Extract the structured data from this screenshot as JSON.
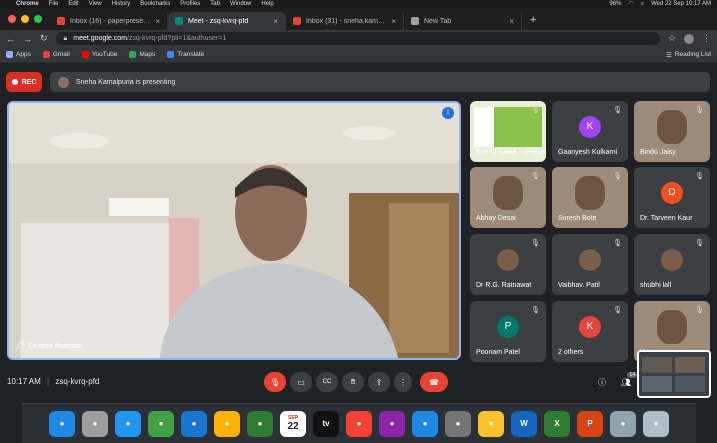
{
  "menubar": {
    "app_name": "Chrome",
    "items": [
      "File",
      "Edit",
      "View",
      "History",
      "Bookmarks",
      "Profiles",
      "Tab",
      "Window",
      "Help"
    ],
    "battery": "96%",
    "datetime": "Wed 22 Sep  10:17 AM"
  },
  "tabs": [
    {
      "title": "Inbox (16) - paperpresentation",
      "color": "#ea4335"
    },
    {
      "title": "Meet - zsq-kvrq-pfd",
      "color": "#00897b",
      "active": true
    },
    {
      "title": "Inbox (31) - sneha.kamalpuria",
      "color": "#ea4335"
    },
    {
      "title": "New Tab",
      "color": "#9aa0a6"
    }
  ],
  "address": {
    "host": "meet.google.com",
    "path": "/zsq-kvrq-pfd?pli=1&authuser=1"
  },
  "bookmarks": {
    "items": [
      {
        "label": "Apps",
        "color": "#8ab4f8"
      },
      {
        "label": "Gmail",
        "color": "#ea4335"
      },
      {
        "label": "YouTube",
        "color": "#ff0000"
      },
      {
        "label": "Maps",
        "color": "#34a853"
      },
      {
        "label": "Translate",
        "color": "#4285f4"
      }
    ],
    "reading_list": "Reading List"
  },
  "meet": {
    "rec_label": "REC",
    "presenting_text": "Sneha Kamalpuria is presenting",
    "main_speaker": "Deepak Asarpota",
    "participants": [
      {
        "name": "Sneha Kama... (Presentati...",
        "kind": "screen"
      },
      {
        "name": "Gaanyesh Kulkarni",
        "initial": "K",
        "color": "#a142f4"
      },
      {
        "name": "Bindu Jaisy",
        "kind": "photo"
      },
      {
        "name": "Abhay Desai",
        "kind": "photo"
      },
      {
        "name": "Suresh Bote",
        "kind": "photo"
      },
      {
        "name": "Dr. Tarveen Kaur",
        "initial": "D",
        "color": "#f4511e"
      },
      {
        "name": "Dr R.G. Ratnawat",
        "kind": "avatar"
      },
      {
        "name": "Vaibhav. Patil",
        "kind": "avatar"
      },
      {
        "name": "shubhi lall",
        "kind": "avatar"
      },
      {
        "name": "Poonam Patel",
        "initial": "P",
        "color": "#00796b"
      },
      {
        "name": "2 others",
        "initial": "K",
        "color": "#e8453c"
      },
      {
        "name": "You",
        "kind": "photo"
      }
    ],
    "clock": "10:17 AM",
    "meeting_code": "zsq-kvrq-pfd",
    "people_count": "14"
  },
  "dock": {
    "apps": [
      {
        "name": "Finder",
        "color": "#1e88e5"
      },
      {
        "name": "Launchpad",
        "color": "#9e9e9e"
      },
      {
        "name": "Safari",
        "color": "#2196f3"
      },
      {
        "name": "Messages",
        "color": "#43a047"
      },
      {
        "name": "Mail",
        "color": "#1976d2"
      },
      {
        "name": "Photos",
        "color": "#ffb300"
      },
      {
        "name": "FaceTime",
        "color": "#2e7d32"
      },
      {
        "name": "Calendar",
        "color": "#ffffff",
        "month": "SEP",
        "day": "22"
      },
      {
        "name": "TV",
        "color": "#111111",
        "text": "tv"
      },
      {
        "name": "Music",
        "color": "#f44336"
      },
      {
        "name": "Podcasts",
        "color": "#8e24aa"
      },
      {
        "name": "App Store",
        "color": "#1e88e5"
      },
      {
        "name": "System Preferences",
        "color": "#757575"
      },
      {
        "name": "Chrome",
        "color": "#fbc02d"
      },
      {
        "name": "Word",
        "color": "#1565c0",
        "text": "W"
      },
      {
        "name": "Excel",
        "color": "#2e7d32",
        "text": "X"
      },
      {
        "name": "PowerPoint",
        "color": "#d84315",
        "text": "P"
      },
      {
        "name": "Preview",
        "color": "#90a4ae"
      },
      {
        "name": "Trash",
        "color": "#b0bec5"
      }
    ]
  }
}
